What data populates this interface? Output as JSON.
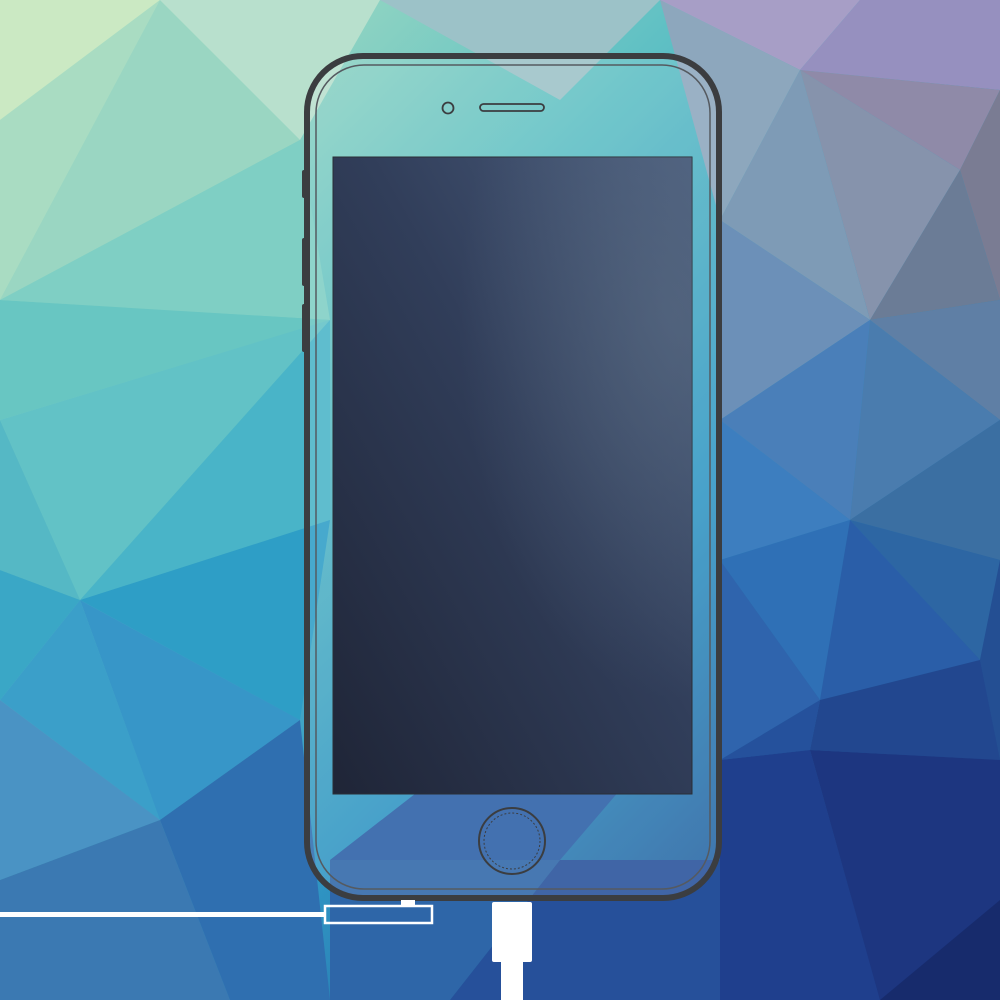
{
  "scene": {
    "subject": "smartphone-outline",
    "screen_state": "off",
    "cable": "lightning-charging-cable"
  },
  "colors": {
    "bg_top_left": "#bfe6c4",
    "bg_mid": "#3fb0c8",
    "bg_bottom_right": "#1e3f8c",
    "phone_frame": "#3b3d40",
    "screen_top": "#3f5073",
    "screen_bottom": "#1f2535",
    "cable": "#ffffff"
  },
  "icons": {
    "camera": "front-camera-icon",
    "speaker": "earpiece-speaker-icon",
    "home": "home-button-icon"
  }
}
